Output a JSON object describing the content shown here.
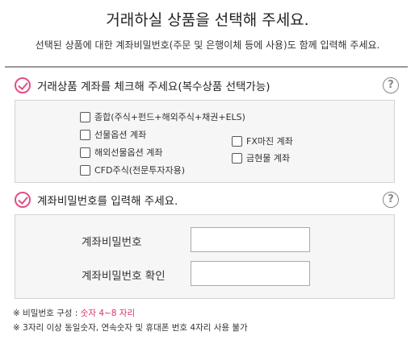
{
  "header": {
    "title": "거래하실 상품을 선택해 주세요.",
    "subtitle": "선택된 상품에 대한 계좌비밀번호(주문 및 은행이체 등에 사용)도 함께 입력해 주세요."
  },
  "section1": {
    "label": "거래상품 계좌를 체크해 주세요(복수상품 선택가능)",
    "help_icon": "?",
    "checkboxes_left": [
      {
        "label": "종합(주식+펀드+해외주식+채권+ELS)",
        "checked": false
      },
      {
        "label": "선물옵션 계좌",
        "checked": false
      },
      {
        "label": "해외선물옵션 계좌",
        "checked": false
      },
      {
        "label": "CFD주식(전문투자자용)",
        "checked": false
      }
    ],
    "checkboxes_right": [
      {
        "label": "FX마진 계좌",
        "checked": false
      },
      {
        "label": "금현물 계좌",
        "checked": false
      }
    ]
  },
  "section2": {
    "label": "계좌비밀번호를 입력해 주세요.",
    "help_icon": "?",
    "password_label": "계좌비밀번호",
    "password_confirm_label": "계좌비밀번호 확인",
    "password_value": "",
    "password_confirm_value": ""
  },
  "notes": {
    "note1_prefix": "※ 비밀번호 구성 : ",
    "note1_highlight": "숫자 4~8 자리",
    "note2": "※ 3자리 이상 동일숫자, 연속숫자 및 휴대폰 번호 4자리 사용 불가"
  },
  "colors": {
    "accent": "#e0508a",
    "note_highlight": "#d6336c",
    "divider": "#999999",
    "box_bg": "#f6f6f6"
  }
}
